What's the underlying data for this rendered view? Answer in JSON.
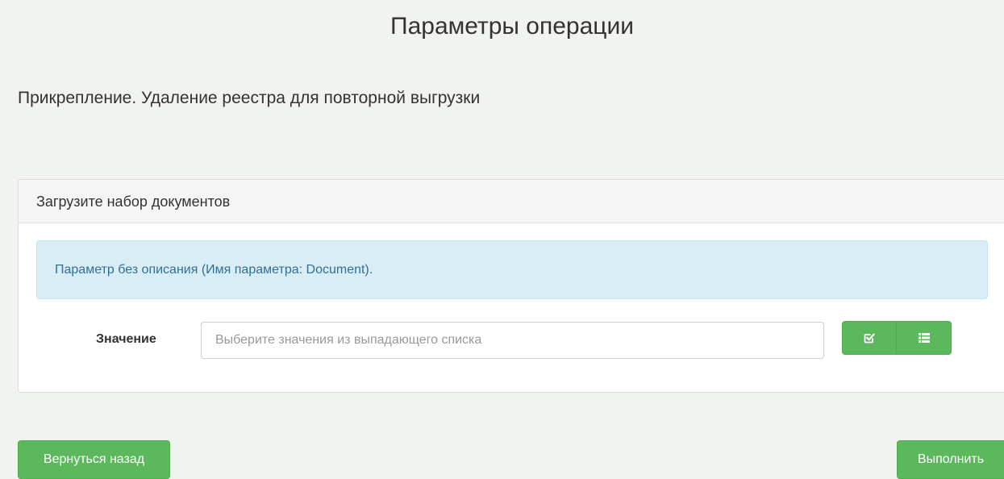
{
  "page": {
    "title": "Параметры операции",
    "operation_name": "Прикрепление. Удаление реестра для повторной выгрузки"
  },
  "panel": {
    "heading": "Загрузите набор документов",
    "info_text": "Параметр без описания (Имя параметра: Document).",
    "field_label": "Значение",
    "input": {
      "value": "",
      "placeholder": "Выберите значения из выпадающего списка"
    },
    "buttons": [
      {
        "icon": "check-square-icon"
      },
      {
        "icon": "list-icon"
      }
    ]
  },
  "footer": {
    "back_label": "Вернуться назад",
    "execute_label": "Выполнить"
  },
  "colors": {
    "primary_green": "#5cb85c",
    "info_background": "#d9edf7",
    "info_text": "#31708f",
    "page_background": "#f1f3ee"
  }
}
